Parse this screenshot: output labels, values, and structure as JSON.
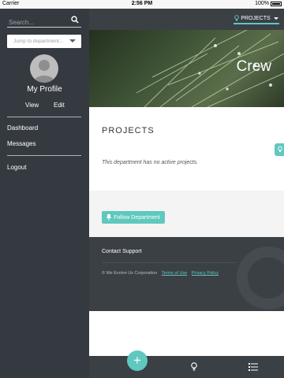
{
  "status_bar": {
    "carrier": "Carrier",
    "time": "2:56 PM",
    "battery": "100%"
  },
  "sidebar": {
    "search_placeholder": "Search...",
    "department_placeholder": "Jump to department...",
    "profile_name": "My Profile",
    "view_label": "View",
    "edit_label": "Edit",
    "nav": [
      {
        "label": "Dashboard"
      },
      {
        "label": "Messages"
      }
    ],
    "logout_label": "Logout"
  },
  "topbar": {
    "projects_label": "PROJECTS"
  },
  "hero": {
    "title": "Crew"
  },
  "projects_section": {
    "title": "PROJECTS",
    "empty_message": "This department has no active projects."
  },
  "follow": {
    "button_label": "Follow Department"
  },
  "footer": {
    "contact_label": "Contact Support",
    "copyright": "© We Evolve Us Corporation",
    "terms_label": "Terms of Use",
    "privacy_label": "Privacy Policy"
  },
  "bottom_bar": {
    "add_label": "+"
  },
  "colors": {
    "accent": "#5fc8bf",
    "sidebar_bg": "#343a40",
    "dark_bar": "#3b4045"
  },
  "icons": {
    "search": "search-icon",
    "chevron": "chevron-down-icon",
    "bulb": "lightbulb-icon",
    "pin": "pin-icon",
    "list": "list-icon",
    "avatar": "avatar-placeholder-icon"
  }
}
